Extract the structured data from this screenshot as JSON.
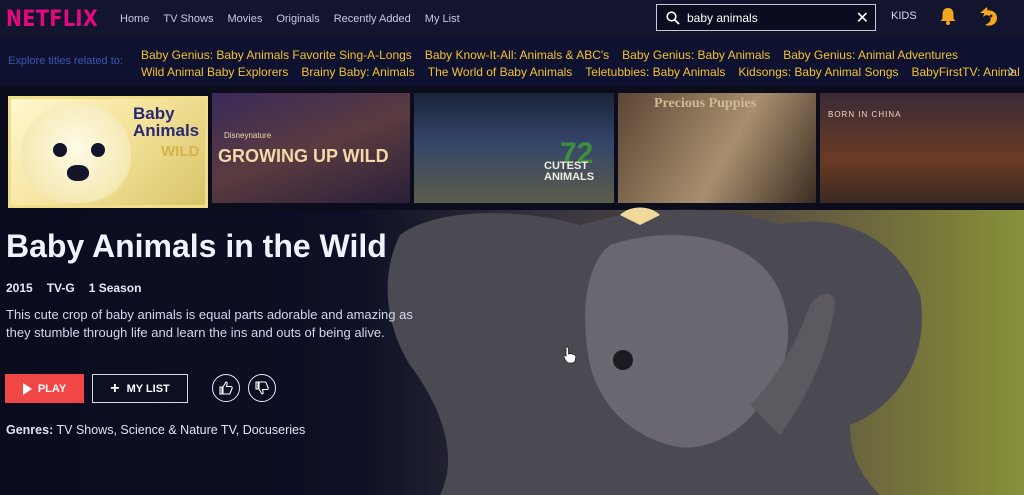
{
  "header": {
    "logo": "NETFLIX",
    "nav": [
      "Home",
      "TV Shows",
      "Movies",
      "Originals",
      "Recently Added",
      "My List"
    ],
    "search_value": "baby animals",
    "kids": "KIDS"
  },
  "explore": {
    "label": "Explore titles related to:",
    "row1": [
      "Baby Genius: Baby Animals Favorite Sing-A-Longs",
      "Baby Know-It-All: Animals & ABC's",
      "Baby Genius: Baby Animals",
      "Baby Genius: Animal Adventures"
    ],
    "row2": [
      "Wild Animal Baby Explorers",
      "Brainy Baby: Animals",
      "The World of Baby Animals",
      "Teletubbies: Baby Animals",
      "Kidsongs: Baby Animal Songs",
      "BabyFirstTV: Animal Ba"
    ]
  },
  "thumbnails": {
    "t1": {
      "title": "Baby Animals",
      "sub": "WILD"
    },
    "t2": {
      "kicker": "Disneynature",
      "title": "GROWING UP WILD"
    },
    "t3": {
      "num": "72",
      "title": "CUTEST ANIMALS"
    },
    "t4": {
      "title": "Precious Puppies"
    },
    "t5": {
      "title": "BORN IN CHINA"
    }
  },
  "show": {
    "title": "Baby Animals in the Wild",
    "year": "2015",
    "rating": "TV-G",
    "seasons": "1 Season",
    "synopsis": "This cute crop of baby animals is equal parts adorable and amazing as they stumble through life and learn the ins and outs of being alive.",
    "play_label": "PLAY",
    "mylist_label": "MY LIST",
    "genres_label": "Genres:",
    "genres": "TV Shows, Science & Nature TV, Docuseries"
  },
  "colors": {
    "accent_red": "#f04746",
    "explore_link": "#f0c42e",
    "logo": "#e5097f"
  }
}
